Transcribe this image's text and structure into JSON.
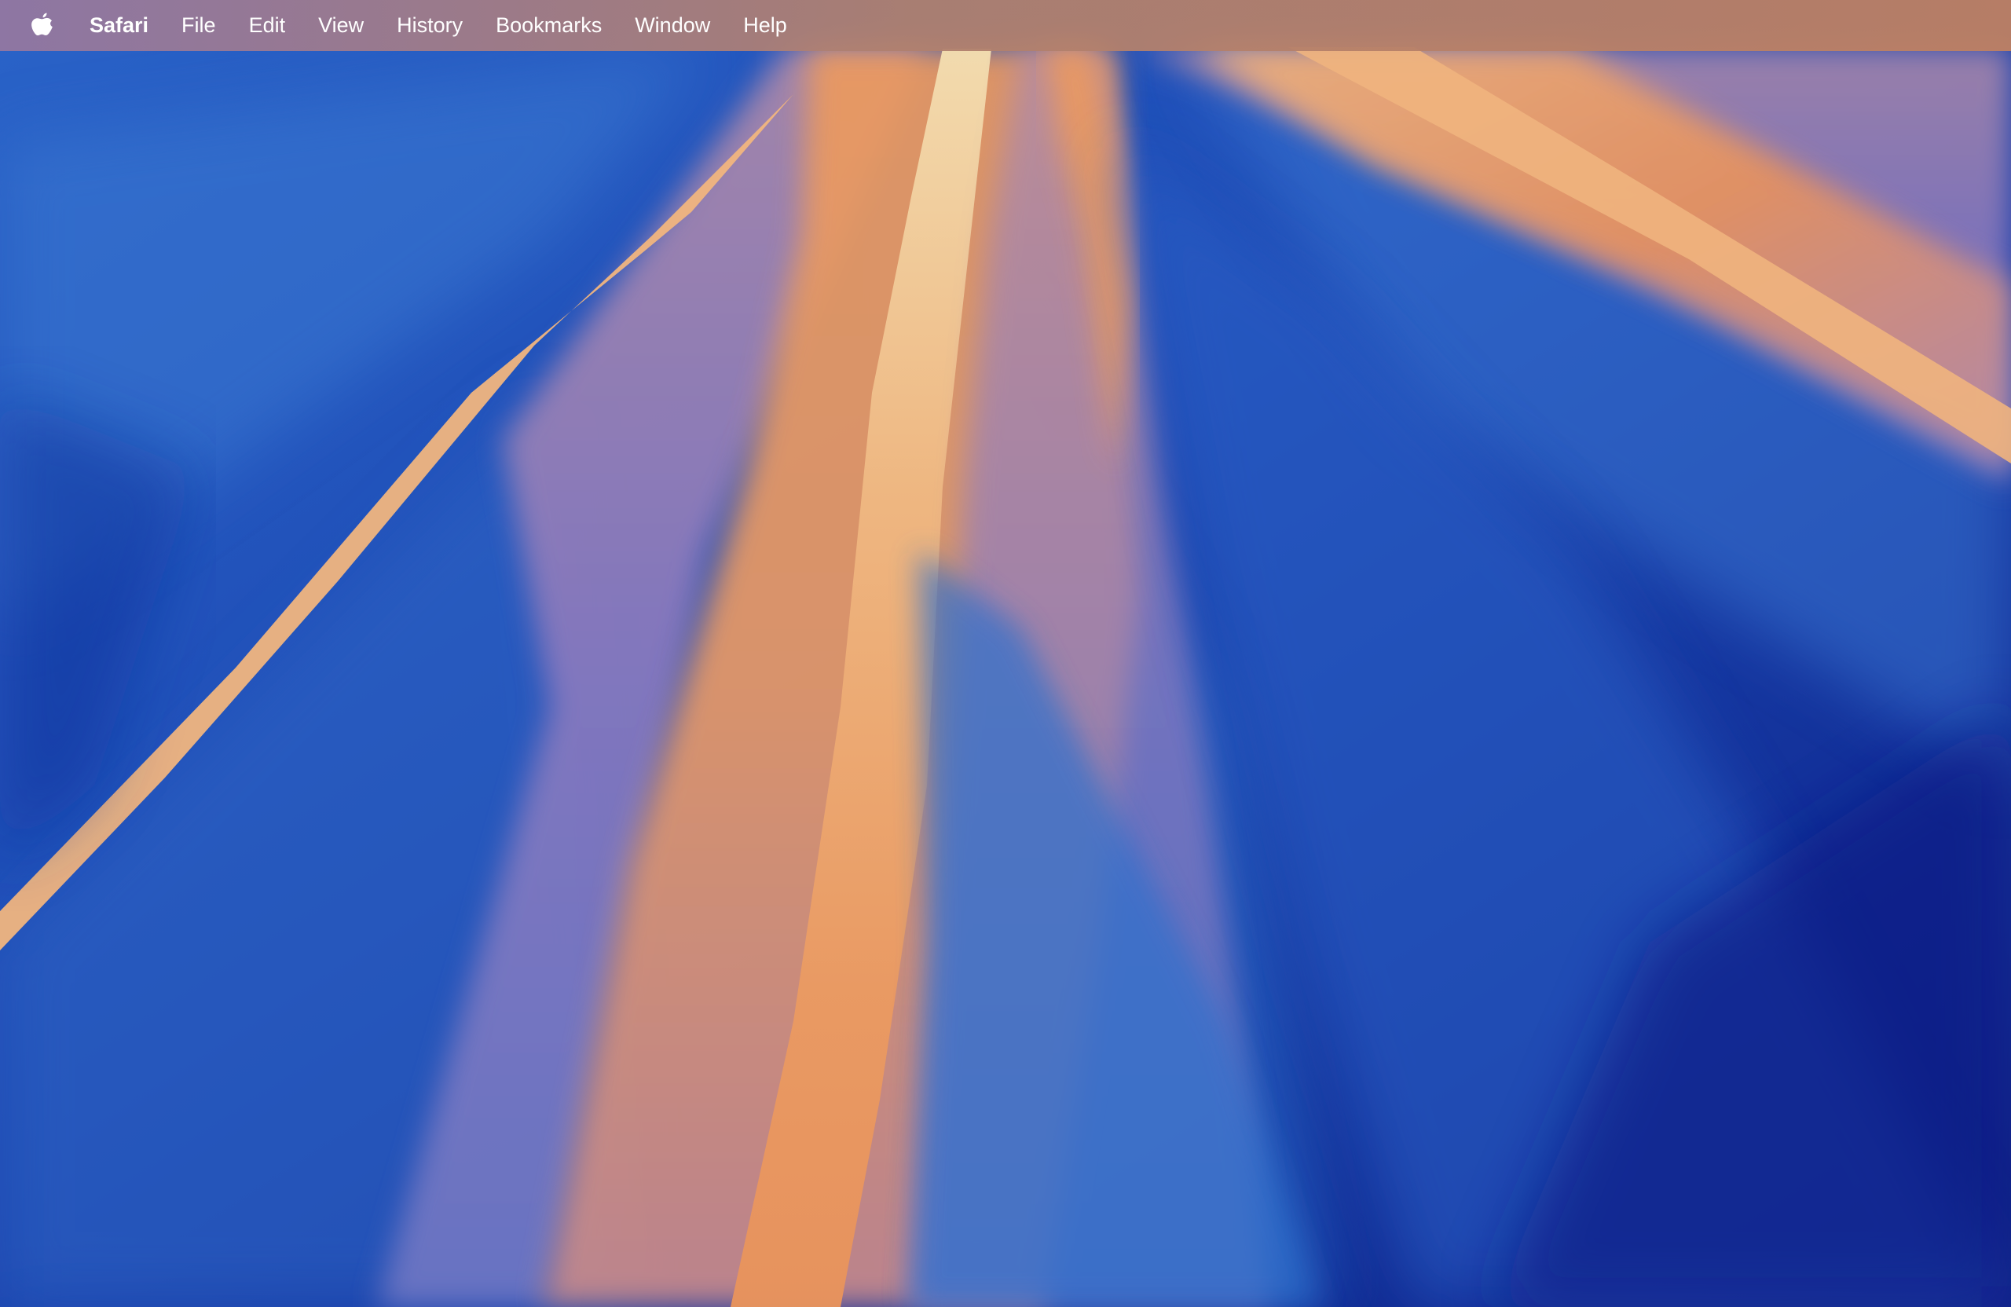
{
  "menubar": {
    "apple_icon": "apple-logo-icon",
    "app_name": "Safari",
    "items": [
      {
        "label": "File"
      },
      {
        "label": "Edit"
      },
      {
        "label": "View"
      },
      {
        "label": "History"
      },
      {
        "label": "Bookmarks"
      },
      {
        "label": "Window"
      },
      {
        "label": "Help"
      }
    ]
  },
  "wallpaper": {
    "colors": {
      "deep_blue": "#0d1f8a",
      "blue": "#2f6fcc",
      "violet": "#8c7bbf",
      "orange": "#ea9a62",
      "peach": "#f2c99a",
      "cream": "#f3ddb0"
    }
  }
}
